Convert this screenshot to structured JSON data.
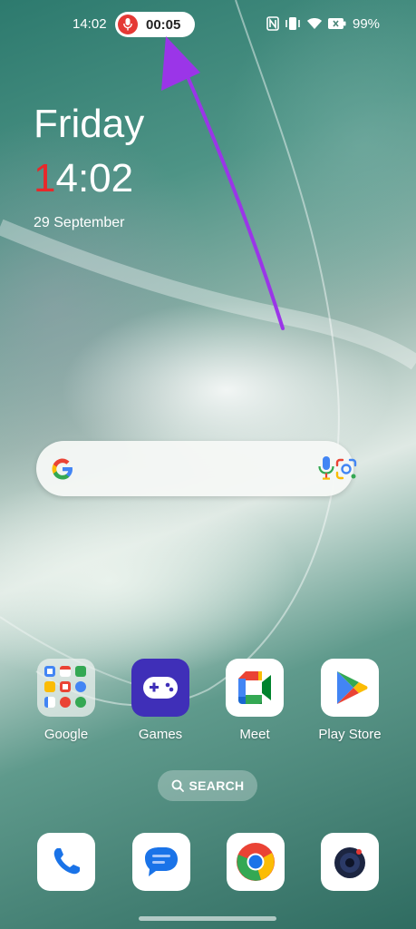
{
  "status_bar": {
    "time": "14:02",
    "recording_timer": "00:05",
    "battery_percent": "99%",
    "icons": [
      "nfc-icon",
      "vibrate-icon",
      "wifi-icon",
      "battery-icon"
    ]
  },
  "clock_widget": {
    "day": "Friday",
    "time_first_digit": "1",
    "time_rest": "4:02",
    "date": "29 September"
  },
  "search_bar": {
    "icons": [
      "google-logo-icon",
      "microphone-icon",
      "google-lens-icon"
    ]
  },
  "apps": [
    {
      "label": "Google",
      "icon": "google-folder-icon"
    },
    {
      "label": "Games",
      "icon": "games-icon"
    },
    {
      "label": "Meet",
      "icon": "meet-icon"
    },
    {
      "label": "Play Store",
      "icon": "play-store-icon"
    }
  ],
  "app_search_button": {
    "label": "SEARCH"
  },
  "dock": [
    {
      "icon": "phone-icon"
    },
    {
      "icon": "messages-icon"
    },
    {
      "icon": "chrome-icon"
    },
    {
      "icon": "camera-icon"
    }
  ],
  "colors": {
    "record_red": "#e53935",
    "annotation_arrow": "#9b35e8",
    "clock_accent": "#e8282a"
  }
}
